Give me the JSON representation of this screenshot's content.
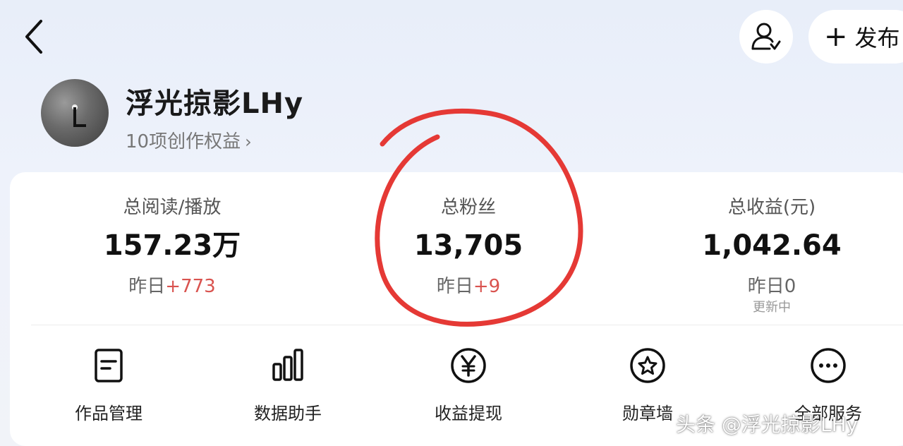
{
  "header": {
    "back_icon": "chevron-left-icon",
    "user_icon": "user-check-icon",
    "publish_label": "发布"
  },
  "profile": {
    "name": "浮光掠影LHy",
    "rights": "10项创作权益"
  },
  "stats": {
    "reads": {
      "label": "总阅读/播放",
      "value": "157.23万",
      "yesterday_prefix": "昨日",
      "yesterday_delta": "+773"
    },
    "fans": {
      "label": "总粉丝",
      "value": "13,705",
      "yesterday_prefix": "昨日",
      "yesterday_delta": "+9"
    },
    "income": {
      "label": "总收益(元)",
      "value": "1,042.64",
      "yesterday": "昨日0",
      "note": "更新中"
    }
  },
  "services": [
    {
      "label": "作品管理",
      "icon": "document-icon"
    },
    {
      "label": "数据助手",
      "icon": "bar-chart-icon"
    },
    {
      "label": "收益提现",
      "icon": "yuan-icon"
    },
    {
      "label": "勋章墙",
      "icon": "medal-icon"
    },
    {
      "label": "全部服务",
      "icon": "more-icon"
    }
  ],
  "watermark": "头条 @浮光掠影LHy",
  "colors": {
    "positive": "#d9534f",
    "annotation": "#e53935"
  }
}
